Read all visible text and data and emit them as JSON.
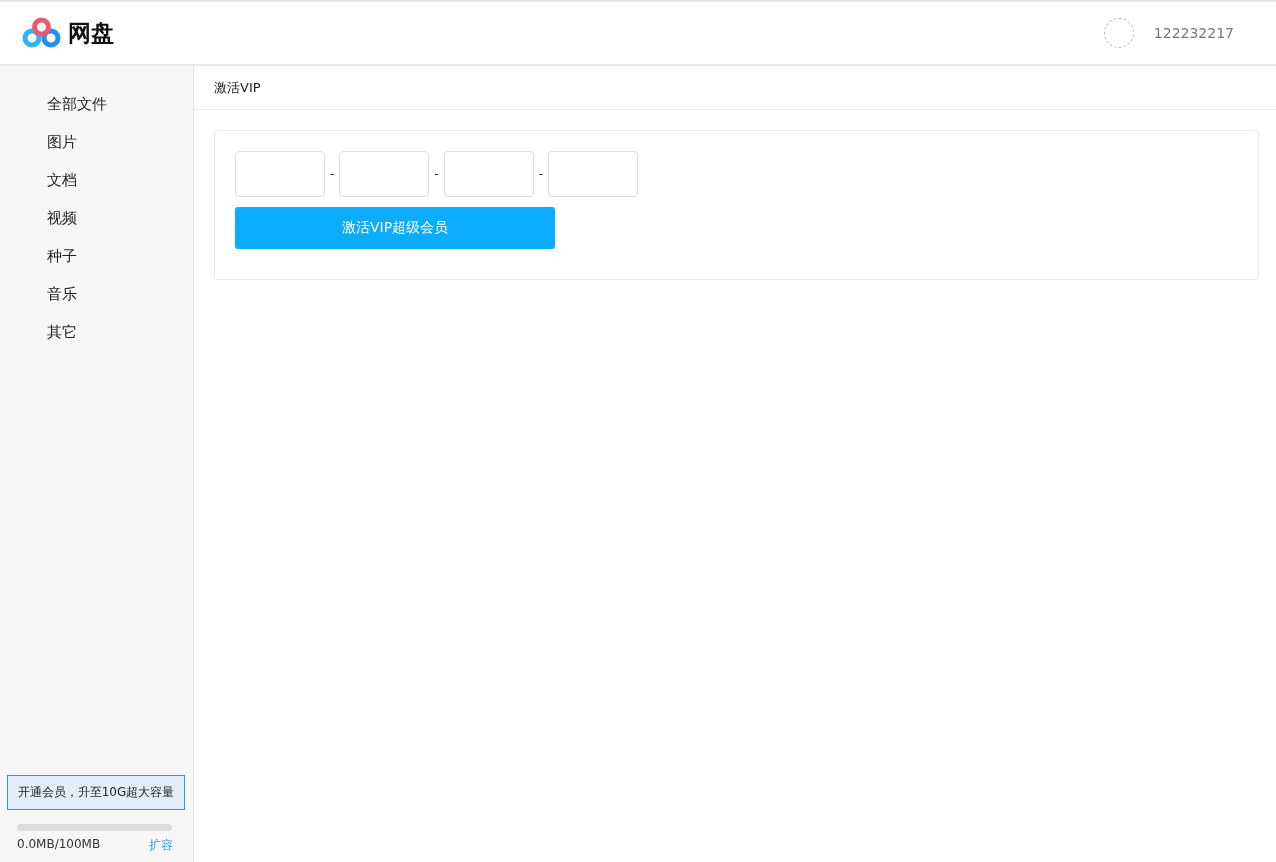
{
  "header": {
    "logo_text": "网盘",
    "username": "122232217"
  },
  "sidebar": {
    "items": [
      "全部文件",
      "图片",
      "文档",
      "视频",
      "种子",
      "音乐",
      "其它"
    ],
    "upgrade_button": "开通会员，升至10G超大容量",
    "storage": {
      "level": 0,
      "reading": "0.0MB/100MB",
      "expand_link": "扩容"
    }
  },
  "breadcrumb": "激活VIP",
  "activation": {
    "separators": [
      "-",
      "-",
      "-"
    ],
    "submit_button": "激活VIP超级会员"
  }
}
